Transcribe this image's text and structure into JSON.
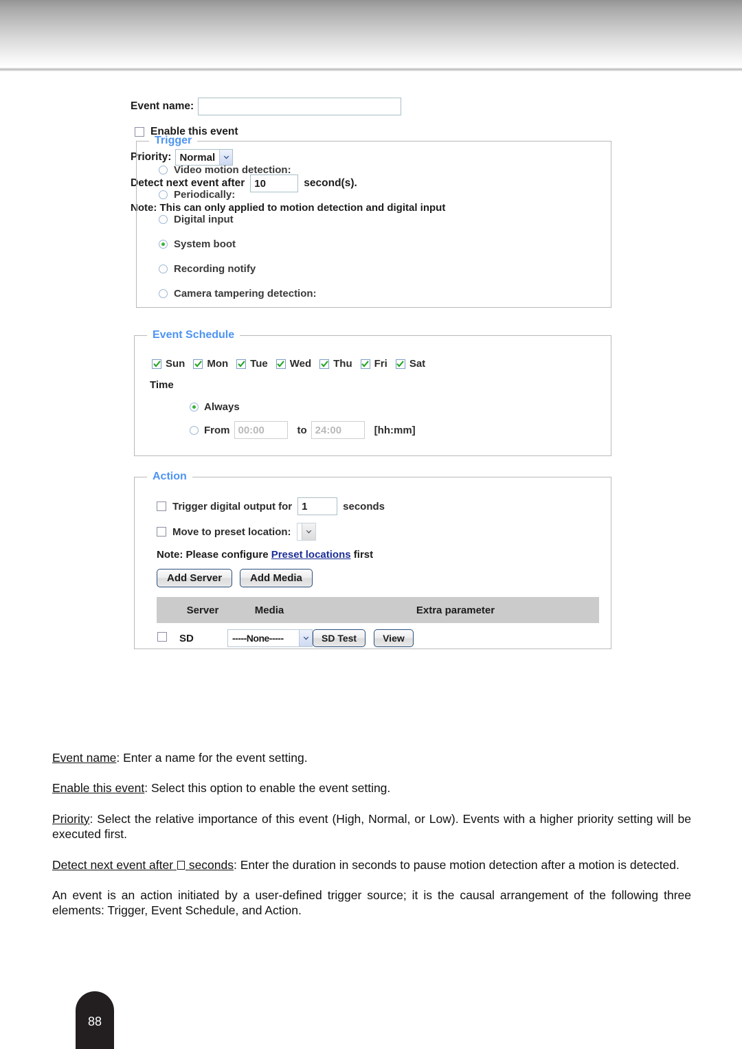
{
  "form": {
    "event_name_label": "Event name:",
    "event_name_value": "",
    "enable_label": "Enable this event",
    "priority_label": "Priority:",
    "priority_value": "Normal",
    "priority_options": [
      "High",
      "Normal",
      "Low"
    ],
    "detect_prefix": "Detect next event after",
    "detect_value": "10",
    "detect_suffix": "second(s).",
    "note": "Note: This can only applied to motion detection and digital input"
  },
  "trigger": {
    "legend": "Trigger",
    "options": [
      {
        "label": "Video motion detection:",
        "selected": false
      },
      {
        "label": "Periodically:",
        "selected": false
      },
      {
        "label": "Digital input",
        "selected": false
      },
      {
        "label": "System boot",
        "selected": true
      },
      {
        "label": "Recording notify",
        "selected": false
      },
      {
        "label": "Camera tampering detection:",
        "selected": false
      }
    ]
  },
  "schedule": {
    "legend": "Event Schedule",
    "days": [
      {
        "label": "Sun",
        "checked": true
      },
      {
        "label": "Mon",
        "checked": true
      },
      {
        "label": "Tue",
        "checked": true
      },
      {
        "label": "Wed",
        "checked": true
      },
      {
        "label": "Thu",
        "checked": true
      },
      {
        "label": "Fri",
        "checked": true
      },
      {
        "label": "Sat",
        "checked": true
      }
    ],
    "time_label": "Time",
    "always_label": "Always",
    "always_selected": true,
    "from_label": "From",
    "from_placeholder": "00:00",
    "from_value": "",
    "to_label": "to",
    "to_placeholder": "24:00",
    "to_value": "",
    "format_label": "[hh:mm]"
  },
  "action": {
    "legend": "Action",
    "digital_output_label": "Trigger digital output for",
    "digital_output_value": "1",
    "digital_output_suffix": "seconds",
    "digital_output_checked": false,
    "preset_label": "Move to preset location:",
    "preset_value": "",
    "preset_checked": false,
    "note_prefix": "Note: Please configure ",
    "note_link": "Preset locations",
    "note_suffix": " first",
    "add_server_label": "Add Server",
    "add_media_label": "Add Media",
    "table": {
      "headers": [
        "",
        "Server",
        "Media",
        "Extra parameter"
      ],
      "rows": [
        {
          "checked": false,
          "server": "SD",
          "media": "-----None-----",
          "buttons": [
            "SD Test",
            "View"
          ]
        }
      ]
    }
  },
  "copy": {
    "p1_term": "Event name",
    "p1_rest": ": Enter a name for the event setting.",
    "p2_term": "Enable this event",
    "p2_rest": ": Select this option to enable the event setting.",
    "p3_term": "Priority",
    "p3_rest": ": Select the relative importance of this event (High, Normal, or Low). Events with a higher priority setting will be executed first.",
    "p4_term_a": "Detect next event after",
    "p4_term_b": "seconds",
    "p4_rest": ": Enter the duration in seconds to pause motion detection after a motion is detected.",
    "p5": "An event is an action initiated by a user-defined trigger source; it is the causal arrangement of the following three elements: Trigger, Event Schedule, and Action."
  },
  "footer": {
    "page_number": "88"
  },
  "colors": {
    "legend_blue": "#4d94f2",
    "link_blue": "#1c2e96",
    "check_green": "#35b435",
    "table_header_gray": "#cbcbcb"
  }
}
